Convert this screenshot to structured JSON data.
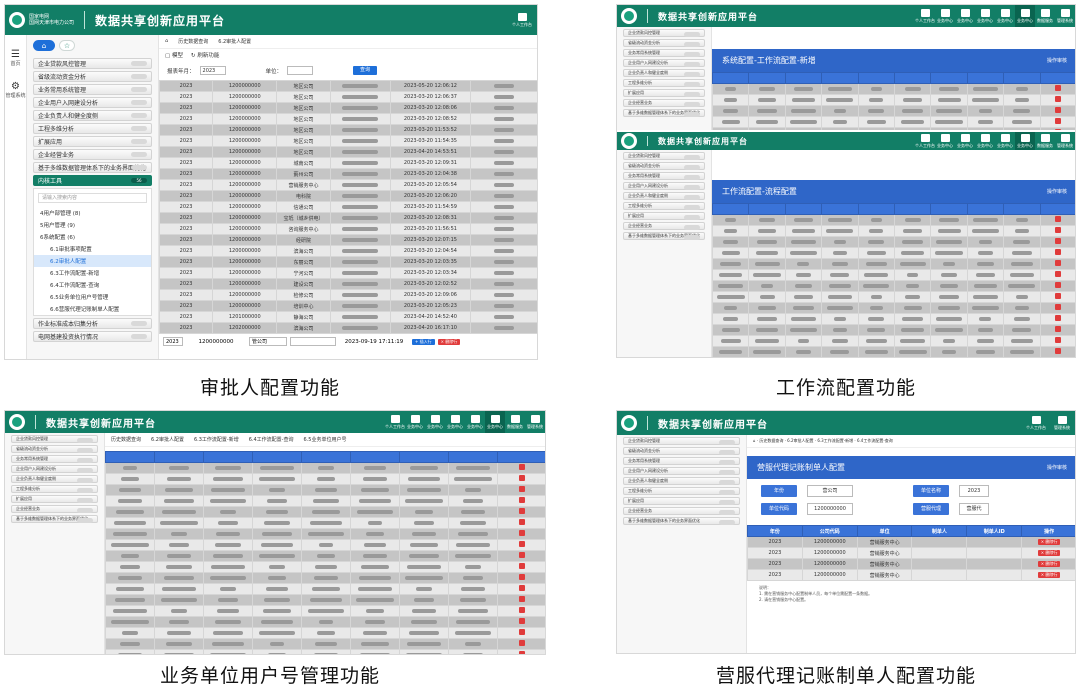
{
  "app": {
    "title": "数据共享创新应用平台",
    "org": "国家电网",
    "org_sub": "国网天津市电力公司",
    "user_center": "个人工作台"
  },
  "rail": {
    "home": "首页",
    "admin": "管理系统"
  },
  "top_icons": [
    "个人工作台",
    "业务中心",
    "业务中心",
    "业务中心",
    "业务中心",
    "业务中心",
    "数据服务",
    "管理系统"
  ],
  "sidebar": {
    "tab_home_icon": "⌂",
    "tab_star_icon": "☆",
    "items": [
      "企业贷款风控管理",
      "省级流动资金分析",
      "业务常用系统管理",
      "企业用户入网建设分析",
      "企业负责人和健全度侧",
      "工程多维分析",
      "扩展应用",
      "企业经营业务",
      "基于多维数据管理体系下的业务界面优化"
    ],
    "open_item": "内核工具",
    "open_badge": "56",
    "search_placeholder": "请输入搜索内容",
    "tree_nodes": [
      "4用户部管理 (8)",
      "5用户管理 (9)",
      "6系统配置 (6)"
    ],
    "tree_leaves": [
      "6.1审批事项配置",
      "6.2审批人配置",
      "6.3工作流配置-新增",
      "6.4工作流配置-查询",
      "6.5业务单位用户号管理",
      "6.6营服代理记账制单人配置"
    ],
    "bottom_items": [
      "作业标准成本归集分析",
      "电网基建投资执行情况"
    ]
  },
  "panel1": {
    "crumbs": [
      "历史数据查询",
      "6.2审批人配置"
    ],
    "toolbar": [
      "模型",
      "刷新功能"
    ],
    "filter": {
      "year_label": "报表年月：",
      "year": "2023",
      "unit_label": "单位：",
      "query": "查询"
    },
    "rows": [
      [
        "2023",
        "1200000000",
        "地区公司",
        "2023-05-20 12:06:12"
      ],
      [
        "2023",
        "1200000000",
        "地区公司",
        "2023-03-20 12:06:37"
      ],
      [
        "2023",
        "1200000000",
        "地区公司",
        "2023-03-20 12:08:06"
      ],
      [
        "2023",
        "1200000000",
        "地区公司",
        "2023-03-20 12:08:52"
      ],
      [
        "2023",
        "1200000000",
        "地区公司",
        "2023-03-20 11:53:52"
      ],
      [
        "2023",
        "1200000000",
        "地区公司",
        "2023-03-20 11:54:35"
      ],
      [
        "2023",
        "1200000000",
        "地区公司",
        "2023-04-20 14:53:51"
      ],
      [
        "2023",
        "1200000000",
        "城南公司",
        "2023-03-20 12:09:31"
      ],
      [
        "2023",
        "1200000000",
        "蓟州公司",
        "2023-03-20 12:04:38"
      ],
      [
        "2023",
        "1200000000",
        "营销服务中心",
        "2023-03-20 12:05:54"
      ],
      [
        "2023",
        "1200000000",
        "电科院",
        "2023-03-20 12:06:20"
      ],
      [
        "2023",
        "1200000000",
        "信通公司",
        "2023-03-20 11:54:59"
      ],
      [
        "2023",
        "1200000000",
        "宝坻（城乡供电）",
        "2023-03-20 12:08:31"
      ],
      [
        "2023",
        "1200000000",
        "咨询服务中心",
        "2023-03-20 11:56:51"
      ],
      [
        "2023",
        "1200000000",
        "经研院",
        "2023-03-20 12:07:15"
      ],
      [
        "2023",
        "1200000000",
        "滨海公司",
        "2023-03-20 12:04:54"
      ],
      [
        "2023",
        "1200000000",
        "东丽公司",
        "2023-03-20 12:03:35"
      ],
      [
        "2023",
        "1200000000",
        "宁河公司",
        "2023-03-20 12:03:34"
      ],
      [
        "2023",
        "1200000000",
        "建设公司",
        "2023-03-20 12:02:52"
      ],
      [
        "2023",
        "1200000000",
        "检修公司",
        "2023-03-20 12:09:06"
      ],
      [
        "2023",
        "1200000000",
        "培训中心",
        "2023-03-20 12:05:23"
      ],
      [
        "2023",
        "1201000000",
        "静海公司",
        "2023-04-20 14:52:40"
      ],
      [
        "2023",
        "1202000000",
        "滨海公司",
        "2023-04-20 16:17:10"
      ]
    ],
    "last_row": {
      "year": "2023",
      "code": "1200000000",
      "unit": "管公司",
      "time": "2023-09-19 17:11:19"
    },
    "add_row": "+ 插入行",
    "del_row": "× 删除行"
  },
  "panel2": {
    "banner": "系统配置-工作流配置-新增",
    "banner2": "工作流配置-流程配置",
    "tag": "操作审核",
    "sub": "流程配置"
  },
  "panel3": {
    "title": "业务单位用户号管理",
    "crumbs": [
      "历史数据查询",
      "6.2审批人配置",
      "6.3工作流配置-新增",
      "6.4工作流配置-查询",
      "6.5业务单位用户号"
    ],
    "del": "× 删除行"
  },
  "panel4": {
    "banner": "营服代理记账制单人配置",
    "tag": "操作审核",
    "form": {
      "year_label": "年份",
      "year": "2023",
      "unit_label": "单位名称",
      "unit": "营公司",
      "code_label": "单位代码",
      "code": "1200000000",
      "zone_label": "营服代理",
      "zone": "营服代",
      "btn": "保存"
    },
    "headers": [
      "年份",
      "公司代码",
      "单位",
      "制单人",
      "制单人ID",
      "操作"
    ],
    "rows": [
      [
        "2023",
        "1200000000",
        "营销服务中心"
      ],
      [
        "2023",
        "1200000000",
        "营销服务中心"
      ],
      [
        "2023",
        "1200000000",
        "营销服务中心"
      ],
      [
        "2023",
        "1200000000",
        "营销服务中心"
      ]
    ],
    "notes": "说明：\n1. 需在营销服务中心配置制单人员，每个单位需配置一条数据。\n2. 请在营销服务中心配置。"
  },
  "captions": [
    "审批人配置功能",
    "工作流配置功能",
    "业务单位用户号管理功能",
    "营服代理记账制单人配置功能"
  ]
}
